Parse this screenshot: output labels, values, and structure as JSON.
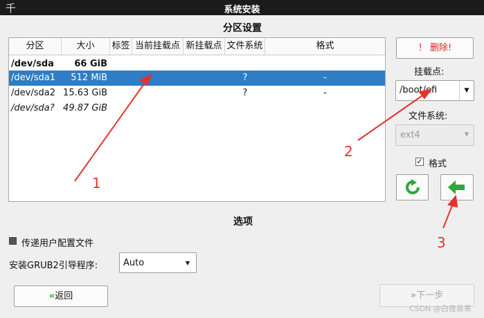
{
  "window": {
    "title": "系统安装",
    "menu_glyph": "千"
  },
  "partition_section": {
    "title": "分区设置"
  },
  "table": {
    "headers": [
      "分区",
      "大小",
      "标签",
      "当前挂载点",
      "新挂载点",
      "文件系统",
      "格式"
    ],
    "rows": [
      {
        "partition": "/dev/sda",
        "size": "66 GiB",
        "label": "",
        "current_mount": "",
        "new_mount": "",
        "fs": "",
        "format": "",
        "style": "bold"
      },
      {
        "partition": "/dev/sda1",
        "size": "512 MiB",
        "label": "",
        "current_mount": "",
        "new_mount": "",
        "fs": "?",
        "format": "-",
        "style": "selected"
      },
      {
        "partition": "/dev/sda2",
        "size": "15.63 GiB",
        "label": "",
        "current_mount": "",
        "new_mount": "",
        "fs": "?",
        "format": "-",
        "style": "normal"
      },
      {
        "partition": "/dev/sda?",
        "size": "49.87 GiB",
        "label": "",
        "current_mount": "",
        "new_mount": "",
        "fs": "",
        "format": "",
        "style": "italic"
      }
    ]
  },
  "right_panel": {
    "delete_label": "！ 删除!",
    "mount_label": "挂载点:",
    "mount_value": "/boot/efi",
    "fs_label": "文件系统:",
    "fs_value": "ext4",
    "format_label": "格式",
    "format_checked": "✓"
  },
  "options": {
    "title": "选项",
    "pass_user_config": "传递用户配置文件",
    "grub_label": "安装GRUB2引导程序:",
    "grub_value": "Auto"
  },
  "nav": {
    "back_label": "返回",
    "back_icon": "«",
    "next_label": "下一步",
    "next_icon": "»"
  },
  "annotations": {
    "n1": "1",
    "n2": "2",
    "n3": "3"
  },
  "watermark": "CSDN @白夜易寒",
  "colors": {
    "selection": "#2f7dc5",
    "delete_text": "#e02020",
    "action_green": "#2fa83a",
    "annotation": "#e8302a"
  }
}
